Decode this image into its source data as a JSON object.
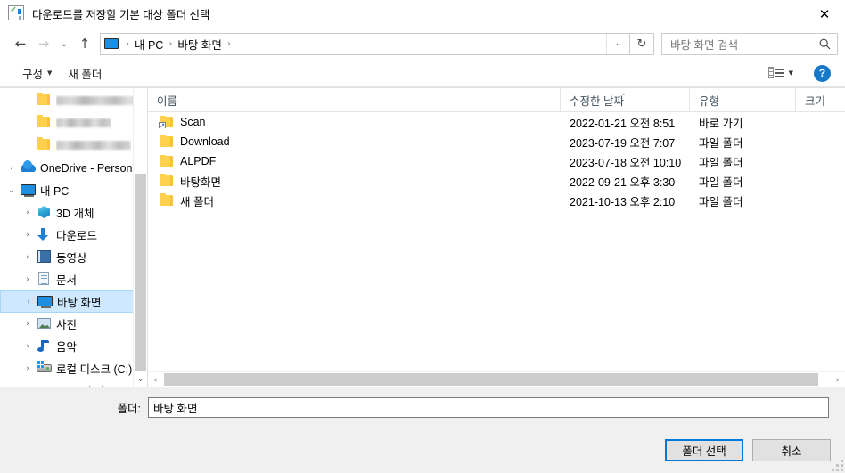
{
  "window": {
    "title": "다운로드를 저장할 기본 대상 폴더 선택",
    "title_icon": "download-save-icon",
    "close_label": "✕"
  },
  "nav": {
    "back_label": "←",
    "forward_label": "→",
    "recent_label": "⌄",
    "up_label": "↑",
    "refresh_label": "↻",
    "dropdown_label": "⌄",
    "breadcrumb_icon": "this-pc-icon",
    "breadcrumbs": [
      {
        "label": "내 PC"
      },
      {
        "label": "바탕 화면"
      }
    ],
    "separator": "›"
  },
  "search": {
    "placeholder": "바탕 화면 검색",
    "icon": "search-icon"
  },
  "toolbar": {
    "organize_label": "구성",
    "organize_caret": "▼",
    "new_folder_label": "새 폴더",
    "view_caret": "▼",
    "help_label": "?"
  },
  "sidebar": {
    "items": [
      {
        "label": "",
        "icon": "folder-icon",
        "indent": 2,
        "expander": "",
        "redacted": true,
        "selected": false
      },
      {
        "label": "",
        "icon": "folder-icon",
        "indent": 2,
        "expander": "",
        "redacted": true,
        "selected": false
      },
      {
        "label": "",
        "icon": "folder-icon",
        "indent": 2,
        "expander": "",
        "redacted": true,
        "selected": false
      },
      {
        "label": "OneDrive - Personal",
        "icon": "onedrive-cloud-icon",
        "indent": 1,
        "expander": "›",
        "redacted": false,
        "selected": false
      },
      {
        "label": "내 PC",
        "icon": "this-pc-icon",
        "indent": 1,
        "expander": "⌄",
        "redacted": false,
        "selected": false
      },
      {
        "label": "3D 개체",
        "icon": "3d-objects-icon",
        "indent": 2,
        "expander": "›",
        "redacted": false,
        "selected": false
      },
      {
        "label": "다운로드",
        "icon": "downloads-icon",
        "indent": 2,
        "expander": "›",
        "redacted": false,
        "selected": false
      },
      {
        "label": "동영상",
        "icon": "videos-icon",
        "indent": 2,
        "expander": "›",
        "redacted": false,
        "selected": false
      },
      {
        "label": "문서",
        "icon": "documents-icon",
        "indent": 2,
        "expander": "›",
        "redacted": false,
        "selected": false
      },
      {
        "label": "바탕 화면",
        "icon": "desktop-icon",
        "indent": 2,
        "expander": "›",
        "redacted": false,
        "selected": true
      },
      {
        "label": "사진",
        "icon": "pictures-icon",
        "indent": 2,
        "expander": "›",
        "redacted": false,
        "selected": false
      },
      {
        "label": "음악",
        "icon": "music-icon",
        "indent": 2,
        "expander": "›",
        "redacted": false,
        "selected": false
      },
      {
        "label": "로컬 디스크 (C:)",
        "icon": "local-disk-icon",
        "indent": 2,
        "expander": "›",
        "redacted": false,
        "selected": false
      },
      {
        "label": "DATA (D:)",
        "icon": "drive-icon",
        "indent": 2,
        "expander": "›",
        "redacted": false,
        "selected": false
      }
    ],
    "scroll_down_label": "⌄"
  },
  "filelist": {
    "columns": [
      {
        "key": "name",
        "label": "이름",
        "sorted": false
      },
      {
        "key": "date",
        "label": "수정한 날짜",
        "sorted": true,
        "sort_mark": "⌄"
      },
      {
        "key": "type",
        "label": "유형",
        "sorted": false
      },
      {
        "key": "size",
        "label": "크기",
        "sorted": false
      }
    ],
    "rows": [
      {
        "name": "Scan",
        "date": "2022-01-21 오전 8:51",
        "type": "바로 가기",
        "size": "",
        "icon": "folder-shortcut-icon"
      },
      {
        "name": "Download",
        "date": "2023-07-19 오전 7:07",
        "type": "파일 폴더",
        "size": "",
        "icon": "folder-icon"
      },
      {
        "name": "ALPDF",
        "date": "2023-07-18 오전 10:10",
        "type": "파일 폴더",
        "size": "",
        "icon": "folder-icon"
      },
      {
        "name": "바탕화면",
        "date": "2022-09-21 오후 3:30",
        "type": "파일 폴더",
        "size": "",
        "icon": "folder-icon"
      },
      {
        "name": "새 폴더",
        "date": "2021-10-13 오후 2:10",
        "type": "파일 폴더",
        "size": "",
        "icon": "folder-icon"
      }
    ],
    "h_scroll_left": "‹",
    "h_scroll_right": "›"
  },
  "footer": {
    "folder_label": "폴더:",
    "folder_value": "바탕 화면",
    "select_button": "폴더 선택",
    "cancel_button": "취소"
  },
  "colors": {
    "accent": "#0078d7",
    "selection": "#cde8ff",
    "folder_yellow": "#ffd04d",
    "help_blue": "#1878c8"
  }
}
